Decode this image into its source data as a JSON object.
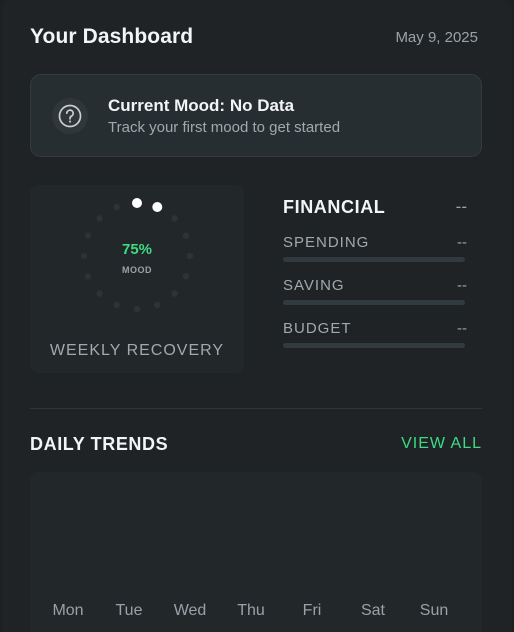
{
  "header": {
    "title": "Your Dashboard",
    "date": "May 9, 2025"
  },
  "mood_card": {
    "icon": "question-circle-icon",
    "title": "Current Mood: No Data",
    "subtitle": "Track your first mood to get started"
  },
  "recovery": {
    "percent_label": "75%",
    "percent_value": 75,
    "sublabel": "MOOD",
    "label": "WEEKLY RECOVERY"
  },
  "financial": {
    "title": "FINANCIAL",
    "value": "--",
    "items": [
      {
        "label": "SPENDING",
        "value": "--",
        "fill": 0
      },
      {
        "label": "SAVING",
        "value": "--",
        "fill": 0
      },
      {
        "label": "BUDGET",
        "value": "--",
        "fill": 0
      }
    ]
  },
  "trends": {
    "title": "DAILY TRENDS",
    "view_all_label": "VIEW ALL",
    "days": [
      "Mon",
      "Tue",
      "Wed",
      "Thu",
      "Fri",
      "Sat",
      "Sun"
    ]
  },
  "colors": {
    "accent": "#3ddc84",
    "background": "#1f2326",
    "card": "#272e31"
  }
}
